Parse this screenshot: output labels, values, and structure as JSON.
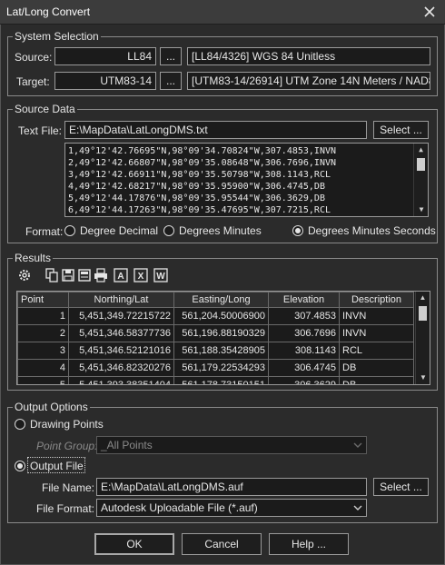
{
  "window": {
    "title": "Lat/Long Convert"
  },
  "system_selection": {
    "group_label": "System Selection",
    "source_label": "Source:",
    "source_value": "LL84",
    "source_browse": "...",
    "source_desc": "[LL84/4326] WGS 84 Unitless",
    "target_label": "Target:",
    "target_value": "UTM83-14",
    "target_browse": "...",
    "target_desc": "[UTM83-14/26914] UTM Zone 14N Meters / NAD83"
  },
  "source_data": {
    "group_label": "Source Data",
    "text_file_label": "Text File:",
    "text_file_value": "E:\\MapData\\LatLongDMS.txt",
    "select_button": "Select ...",
    "lines": [
      "1,49°12'42.76695\"N,98°09'34.70824\"W,307.4853,INVN",
      "2,49°12'42.66807\"N,98°09'35.08648\"W,306.7696,INVN",
      "3,49°12'42.66911\"N,98°09'35.50798\"W,308.1143,RCL",
      "4,49°12'42.68217\"N,98°09'35.95900\"W,306.4745,DB",
      "5,49°12'44.17876\"N,98°09'35.95544\"W,306.3629,DB",
      "6,49°12'44.17263\"N,98°09'35.47695\"W,307.7215,RCL"
    ],
    "format_label": "Format:",
    "formats": [
      "Degree Decimal",
      "Degrees Minutes",
      "Degrees Minutes Seconds"
    ],
    "selected_format": "Degrees Minutes Seconds"
  },
  "results": {
    "group_label": "Results",
    "toolbar_icons": [
      "settings-icon",
      "copy-icon",
      "save-icon",
      "save-as-icon",
      "print-icon",
      "export-autocad-icon",
      "export-excel-icon",
      "export-word-icon"
    ],
    "columns": [
      "Point",
      "Northing/Lat",
      "Easting/Long",
      "Elevation",
      "Description"
    ],
    "rows": [
      [
        "1",
        "5,451,349.72215722",
        "561,204.50006900",
        "307.4853",
        "INVN"
      ],
      [
        "2",
        "5,451,346.58377736",
        "561,196.88190329",
        "306.7696",
        "INVN"
      ],
      [
        "3",
        "5,451,346.52121016",
        "561,188.35428905",
        "308.1143",
        "RCL"
      ],
      [
        "4",
        "5,451,346.82320276",
        "561,179.22534293",
        "306.4745",
        "DB"
      ],
      [
        "5",
        "5,451,393.38351404",
        "561,178.73150151",
        "306.3629",
        "DB"
      ]
    ]
  },
  "output_options": {
    "group_label": "Output Options",
    "drawing_points_label": "Drawing Points",
    "point_group_label": "Point Group:",
    "point_group_value": "_All Points",
    "output_file_label": "Output File",
    "file_name_label": "File Name:",
    "file_name_value": "E:\\MapData\\LatLongDMS.auf",
    "select_button": "Select ...",
    "file_format_label": "File Format:",
    "file_format_value": "Autodesk Uploadable File (*.auf)",
    "selected_output": "Output File"
  },
  "buttons": {
    "ok": "OK",
    "cancel": "Cancel",
    "help": "Help ..."
  }
}
